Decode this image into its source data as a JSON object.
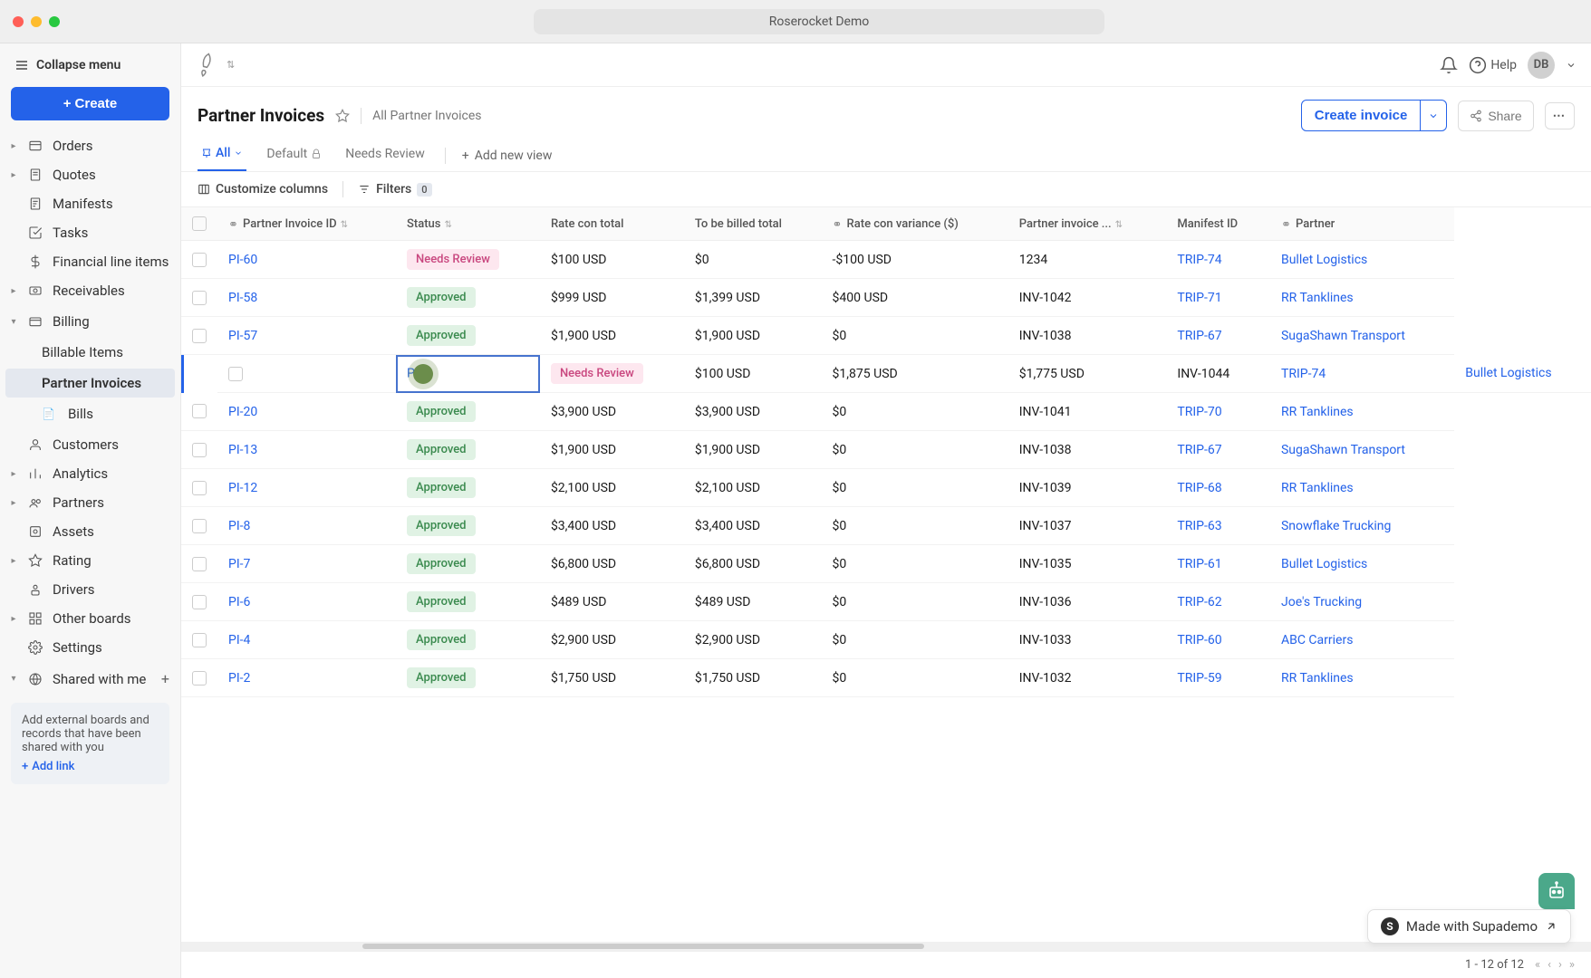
{
  "window": {
    "title": "Roserocket Demo"
  },
  "topbar": {
    "help_label": "Help",
    "avatar_initials": "DB"
  },
  "sidebar": {
    "collapse_label": "Collapse menu",
    "create_label": "Create",
    "items": [
      {
        "label": "Orders",
        "has_caret": true
      },
      {
        "label": "Quotes",
        "has_caret": true
      },
      {
        "label": "Manifests",
        "has_caret": false
      },
      {
        "label": "Tasks",
        "has_caret": false
      },
      {
        "label": "Financial line items",
        "has_caret": false
      },
      {
        "label": "Receivables",
        "has_caret": true
      }
    ],
    "billing": {
      "label": "Billing",
      "children": [
        {
          "label": "Billable Items"
        },
        {
          "label": "Partner Invoices",
          "active": true
        },
        {
          "label": "Bills"
        }
      ]
    },
    "items2": [
      {
        "label": "Customers",
        "has_caret": false
      },
      {
        "label": "Analytics",
        "has_caret": true
      },
      {
        "label": "Partners",
        "has_caret": true
      },
      {
        "label": "Assets",
        "has_caret": false
      },
      {
        "label": "Rating",
        "has_caret": true
      },
      {
        "label": "Drivers",
        "has_caret": false
      },
      {
        "label": "Other boards",
        "has_caret": true
      },
      {
        "label": "Settings",
        "has_caret": false
      }
    ],
    "shared": {
      "label": "Shared with me"
    },
    "shared_card": {
      "text": "Add external boards and records that have been shared with you",
      "link": "Add link"
    }
  },
  "page": {
    "title": "Partner Invoices",
    "subtitle": "All Partner Invoices",
    "create_invoice": "Create invoice",
    "share": "Share",
    "tabs": {
      "all": "All",
      "default": "Default",
      "needs_review": "Needs Review",
      "add_view": "Add new view"
    },
    "toolbar": {
      "customize": "Customize columns",
      "filters": "Filters",
      "filter_count": "0"
    }
  },
  "table": {
    "columns": {
      "invoice_id": "Partner Invoice ID",
      "status": "Status",
      "rate_con_total": "Rate con total",
      "to_be_billed": "To be billed total",
      "variance": "Rate con variance ($)",
      "partner_invoice": "Partner invoice ...",
      "manifest": "Manifest ID",
      "partner": "Partner"
    },
    "rows": [
      {
        "id": "PI-60",
        "status": "Needs Review",
        "rate_con": "$100 USD",
        "to_be_billed": "$0",
        "variance": "-$100 USD",
        "partner_invoice": "1234",
        "manifest": "TRIP-74",
        "partner": "Bullet Logistics"
      },
      {
        "id": "PI-58",
        "status": "Approved",
        "rate_con": "$999 USD",
        "to_be_billed": "$1,399 USD",
        "variance": "$400 USD",
        "partner_invoice": "INV-1042",
        "manifest": "TRIP-71",
        "partner": "RR Tanklines"
      },
      {
        "id": "PI-57",
        "status": "Approved",
        "rate_con": "$1,900 USD",
        "to_be_billed": "$1,900 USD",
        "variance": "$0",
        "partner_invoice": "INV-1038",
        "manifest": "TRIP-67",
        "partner": "SugaShawn Transport"
      },
      {
        "id": "P",
        "status": "Needs Review",
        "rate_con": "$100 USD",
        "to_be_billed": "$1,875 USD",
        "variance": "$1,775 USD",
        "partner_invoice": "INV-1044",
        "manifest": "TRIP-74",
        "partner": "Bullet Logistics",
        "highlighted": true
      },
      {
        "id": "PI-20",
        "status": "Approved",
        "rate_con": "$3,900 USD",
        "to_be_billed": "$3,900 USD",
        "variance": "$0",
        "partner_invoice": "INV-1041",
        "manifest": "TRIP-70",
        "partner": "RR Tanklines"
      },
      {
        "id": "PI-13",
        "status": "Approved",
        "rate_con": "$1,900 USD",
        "to_be_billed": "$1,900 USD",
        "variance": "$0",
        "partner_invoice": "INV-1038",
        "manifest": "TRIP-67",
        "partner": "SugaShawn Transport"
      },
      {
        "id": "PI-12",
        "status": "Approved",
        "rate_con": "$2,100 USD",
        "to_be_billed": "$2,100 USD",
        "variance": "$0",
        "partner_invoice": "INV-1039",
        "manifest": "TRIP-68",
        "partner": "RR Tanklines"
      },
      {
        "id": "PI-8",
        "status": "Approved",
        "rate_con": "$3,400 USD",
        "to_be_billed": "$3,400 USD",
        "variance": "$0",
        "partner_invoice": "INV-1037",
        "manifest": "TRIP-63",
        "partner": "Snowflake Trucking"
      },
      {
        "id": "PI-7",
        "status": "Approved",
        "rate_con": "$6,800 USD",
        "to_be_billed": "$6,800 USD",
        "variance": "$0",
        "partner_invoice": "INV-1035",
        "manifest": "TRIP-61",
        "partner": "Bullet Logistics"
      },
      {
        "id": "PI-6",
        "status": "Approved",
        "rate_con": "$489 USD",
        "to_be_billed": "$489 USD",
        "variance": "$0",
        "partner_invoice": "INV-1036",
        "manifest": "TRIP-62",
        "partner": "Joe's Trucking"
      },
      {
        "id": "PI-4",
        "status": "Approved",
        "rate_con": "$2,900 USD",
        "to_be_billed": "$2,900 USD",
        "variance": "$0",
        "partner_invoice": "INV-1033",
        "manifest": "TRIP-60",
        "partner": "ABC Carriers"
      },
      {
        "id": "PI-2",
        "status": "Approved",
        "rate_con": "$1,750 USD",
        "to_be_billed": "$1,750 USD",
        "variance": "$0",
        "partner_invoice": "INV-1032",
        "manifest": "TRIP-59",
        "partner": "RR Tanklines"
      }
    ]
  },
  "pagination": {
    "text": "1 - 12 of 12"
  },
  "supademo": {
    "label": "Made with Supademo"
  }
}
